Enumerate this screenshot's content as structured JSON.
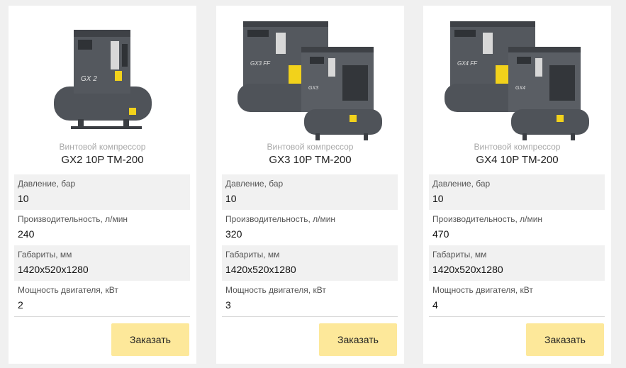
{
  "products": [
    {
      "category": "Винтовой компрессор",
      "model": "GX2 10P TM-200",
      "image_icon": "compressor-single-image",
      "specs": [
        {
          "label": "Давление, бар",
          "value": "10"
        },
        {
          "label": "Производительность, л/мин",
          "value": "240"
        },
        {
          "label": "Габариты, мм",
          "value": "1420x520x1280"
        },
        {
          "label": "Мощность двигателя, кВт",
          "value": "2"
        }
      ],
      "order_label": "Заказать"
    },
    {
      "category": "Винтовой компрессор",
      "model": "GX3 10P TM-200",
      "image_icon": "compressor-double-image",
      "specs": [
        {
          "label": "Давление, бар",
          "value": "10"
        },
        {
          "label": "Производительность, л/мин",
          "value": "320"
        },
        {
          "label": "Габариты, мм",
          "value": "1420x520x1280"
        },
        {
          "label": "Мощность двигателя, кВт",
          "value": "3"
        }
      ],
      "order_label": "Заказать"
    },
    {
      "category": "Винтовой компрессор",
      "model": "GX4 10P TM-200",
      "image_icon": "compressor-double-image",
      "specs": [
        {
          "label": "Давление, бар",
          "value": "10"
        },
        {
          "label": "Производительность, л/мин",
          "value": "470"
        },
        {
          "label": "Габариты, мм",
          "value": "1420x520x1280"
        },
        {
          "label": "Мощность двигателя, кВт",
          "value": "4"
        }
      ],
      "order_label": "Заказать"
    }
  ],
  "colors": {
    "page_bg": "#f0f0f0",
    "card_bg": "#ffffff",
    "shaded_row": "#f1f1f1",
    "button_bg": "#fde89a",
    "machine_body": "#4a4e54"
  }
}
